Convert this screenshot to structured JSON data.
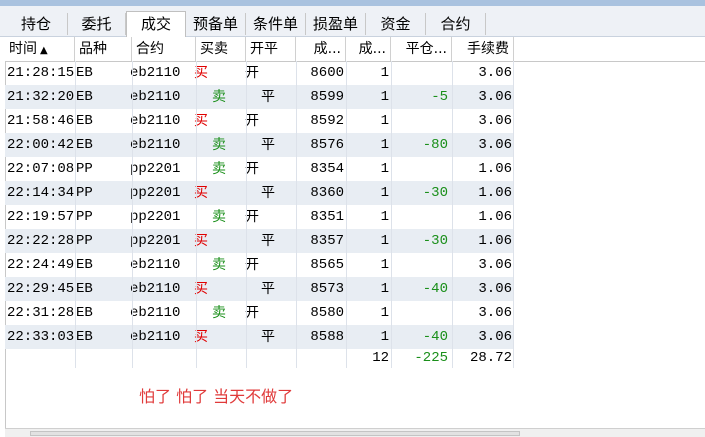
{
  "tabs": [
    "持仓",
    "委托",
    "成交",
    "预备单",
    "条件单",
    "损盈单",
    "资金",
    "合约"
  ],
  "active_tab": "成交",
  "columns": {
    "time": "时间",
    "sort_icon": "▲",
    "variety": "品种",
    "contract": "合约",
    "side": "买卖",
    "open_close": "开平",
    "price": "成...",
    "volume": "成...",
    "close_pnl": "平仓...",
    "fee": "手续费"
  },
  "rows": [
    {
      "time": "21:28:15",
      "variety": "EB",
      "contract": "eb2110",
      "side": "买",
      "oc": "开",
      "price": "8600",
      "vol": "1",
      "pnl": "",
      "fee": "3.06"
    },
    {
      "time": "21:32:20",
      "variety": "EB",
      "contract": "eb2110",
      "side": "卖",
      "oc": "平",
      "price": "8599",
      "vol": "1",
      "pnl": "-5",
      "fee": "3.06"
    },
    {
      "time": "21:58:46",
      "variety": "EB",
      "contract": "eb2110",
      "side": "买",
      "oc": "开",
      "price": "8592",
      "vol": "1",
      "pnl": "",
      "fee": "3.06"
    },
    {
      "time": "22:00:42",
      "variety": "EB",
      "contract": "eb2110",
      "side": "卖",
      "oc": "平",
      "price": "8576",
      "vol": "1",
      "pnl": "-80",
      "fee": "3.06"
    },
    {
      "time": "22:07:08",
      "variety": "PP",
      "contract": "pp2201",
      "side": "卖",
      "oc": "开",
      "price": "8354",
      "vol": "1",
      "pnl": "",
      "fee": "1.06"
    },
    {
      "time": "22:14:34",
      "variety": "PP",
      "contract": "pp2201",
      "side": "买",
      "oc": "平",
      "price": "8360",
      "vol": "1",
      "pnl": "-30",
      "fee": "1.06"
    },
    {
      "time": "22:19:57",
      "variety": "PP",
      "contract": "pp2201",
      "side": "卖",
      "oc": "开",
      "price": "8351",
      "vol": "1",
      "pnl": "",
      "fee": "1.06"
    },
    {
      "time": "22:22:28",
      "variety": "PP",
      "contract": "pp2201",
      "side": "买",
      "oc": "平",
      "price": "8357",
      "vol": "1",
      "pnl": "-30",
      "fee": "1.06"
    },
    {
      "time": "22:24:49",
      "variety": "EB",
      "contract": "eb2110",
      "side": "卖",
      "oc": "开",
      "price": "8565",
      "vol": "1",
      "pnl": "",
      "fee": "3.06"
    },
    {
      "time": "22:29:45",
      "variety": "EB",
      "contract": "eb2110",
      "side": "买",
      "oc": "平",
      "price": "8573",
      "vol": "1",
      "pnl": "-40",
      "fee": "3.06"
    },
    {
      "time": "22:31:28",
      "variety": "EB",
      "contract": "eb2110",
      "side": "卖",
      "oc": "开",
      "price": "8580",
      "vol": "1",
      "pnl": "",
      "fee": "3.06"
    },
    {
      "time": "22:33:03",
      "variety": "EB",
      "contract": "eb2110",
      "side": "买",
      "oc": "平",
      "price": "8588",
      "vol": "1",
      "pnl": "-40",
      "fee": "3.06"
    }
  ],
  "totals": {
    "vol": "12",
    "pnl": "-225",
    "fee": "28.72"
  },
  "note": "怕了 怕了  当天不做了",
  "colors": {
    "buy": "#e00000",
    "sell": "#1a8f1a",
    "note": "#e03a3a",
    "row_alt": "#e8edf3"
  }
}
